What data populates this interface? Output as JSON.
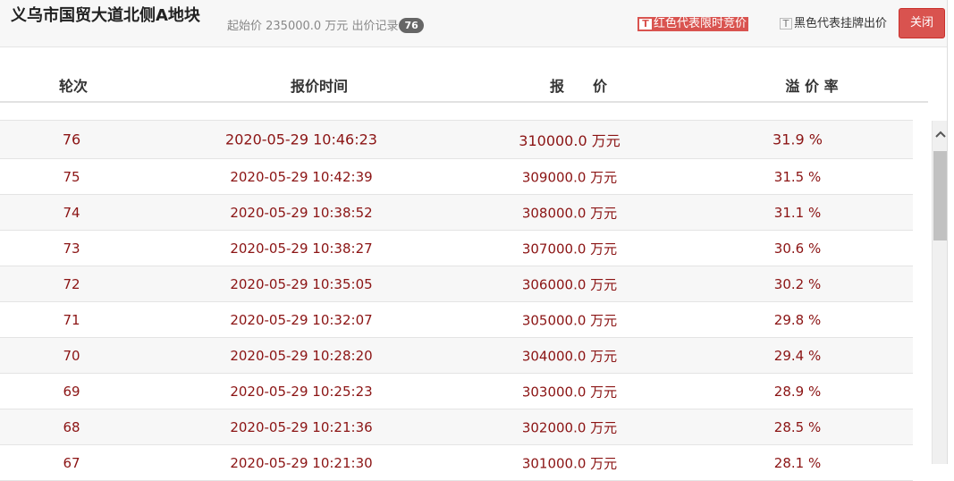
{
  "header": {
    "title": "义乌市国贸大道北侧A地块",
    "start_price_label": "起始价 235000.0 万元",
    "record_label": "出价记录",
    "record_count": "76",
    "legend_red": "红色代表限时竞价",
    "legend_black": "黑色代表挂牌出价",
    "legend_icon": "T",
    "close_label": "关闭",
    "colors": {
      "red": "#d9534f",
      "row_text": "#8b1414"
    }
  },
  "table": {
    "columns": [
      "轮次",
      "报价时间",
      "报　　价",
      "溢 价 率"
    ],
    "rows": [
      {
        "round": "76",
        "time": "2020-05-29 10:46:23",
        "price": "310000.0 万元",
        "premium": "31.9 %"
      },
      {
        "round": "75",
        "time": "2020-05-29 10:42:39",
        "price": "309000.0 万元",
        "premium": "31.5 %"
      },
      {
        "round": "74",
        "time": "2020-05-29 10:38:52",
        "price": "308000.0 万元",
        "premium": "31.1 %"
      },
      {
        "round": "73",
        "time": "2020-05-29 10:38:27",
        "price": "307000.0 万元",
        "premium": "30.6 %"
      },
      {
        "round": "72",
        "time": "2020-05-29 10:35:05",
        "price": "306000.0 万元",
        "premium": "30.2 %"
      },
      {
        "round": "71",
        "time": "2020-05-29 10:32:07",
        "price": "305000.0 万元",
        "premium": "29.8 %"
      },
      {
        "round": "70",
        "time": "2020-05-29 10:28:20",
        "price": "304000.0 万元",
        "premium": "29.4 %"
      },
      {
        "round": "69",
        "time": "2020-05-29 10:25:23",
        "price": "303000.0 万元",
        "premium": "28.9 %"
      },
      {
        "round": "68",
        "time": "2020-05-29 10:21:36",
        "price": "302000.0 万元",
        "premium": "28.5 %"
      },
      {
        "round": "67",
        "time": "2020-05-29 10:21:30",
        "price": "301000.0 万元",
        "premium": "28.1 %"
      }
    ]
  },
  "scrollbar": {
    "up_icon": "chevron-up-icon"
  }
}
